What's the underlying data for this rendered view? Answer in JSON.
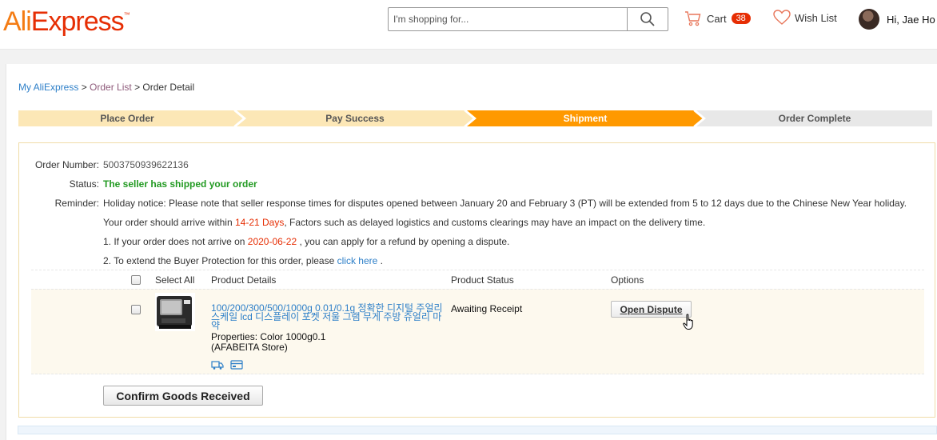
{
  "header": {
    "logo_ali": "Ali",
    "logo_express": "Express",
    "search_placeholder": "I'm shopping for...",
    "cart_label": "Cart",
    "cart_count": "38",
    "wishlist_label": "Wish List",
    "user_label": "Hi, Jae Ho"
  },
  "breadcrumb": {
    "my_aliexpress": "My AliExpress",
    "sep1": " > ",
    "order_list": "Order List",
    "sep2": " > ",
    "current": "Order Detail"
  },
  "steps": [
    {
      "label": "Place Order"
    },
    {
      "label": "Pay Success"
    },
    {
      "label": "Shipment"
    },
    {
      "label": "Order Complete"
    }
  ],
  "order": {
    "number_label": "Order Number:",
    "number": "5003750939622136",
    "status_label": "Status:",
    "status": "The seller has shipped your order",
    "reminder_label": "Reminder:",
    "holiday_notice": "Holiday notice: Please note that seller response times for disputes opened between January 20 and February 3 (PT) will be extended from 5 to 12 days due to the Chinese New Year holiday.",
    "arrive_pre": "Your order should arrive within ",
    "arrive_days": "14-21 Days",
    "arrive_post": ", Factors such as delayed logistics and customs clearings may have an impact on the delivery time.",
    "refund_pre": "1. If your order does not arrive on ",
    "refund_date": "2020-06-22",
    "refund_post": " , you can apply for a refund by opening a dispute.",
    "extend_pre": "2. To extend the Buyer Protection for this order, please ",
    "extend_link": "click here",
    "extend_post": " ."
  },
  "products": {
    "select_all": "Select All",
    "col_details": "Product Details",
    "col_status": "Product Status",
    "col_options": "Options",
    "item": {
      "title": "100/200/300/500/1000g 0.01/0.1g 정확한 디지털 주얼리 스케일 lcd 디스플레이 포켓 저울 그램 무게 주방 쥬얼리 마약",
      "properties": "Properties: Color 1000g0.1",
      "store": "(AFABEITA Store)",
      "status": "Awaiting Receipt",
      "dispute_button": "Open Dispute"
    }
  },
  "confirm_button": "Confirm Goods Received",
  "colors": {
    "brand_orange": "#f47c14",
    "brand_red": "#e62e04",
    "step_done": "#fce7b6",
    "step_active": "#ff9900",
    "step_pending": "#e8e8e8",
    "link_blue": "#2d7fc8",
    "status_green": "#229a22"
  }
}
